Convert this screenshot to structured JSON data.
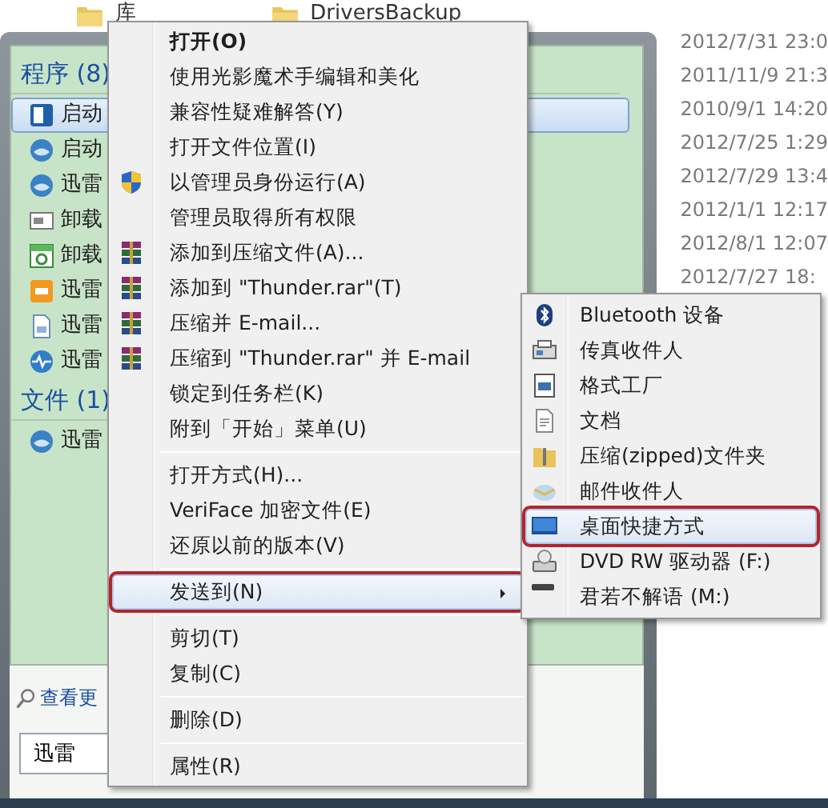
{
  "explorer": {
    "folders": [
      {
        "name": "库"
      },
      {
        "name": "DriversBackup"
      }
    ],
    "dates": [
      "2012/7/31 23:0",
      "2011/11/9 21:3",
      "2010/9/1 14:20",
      "2012/7/25 1:29",
      "2012/7/29 13:4",
      "2012/1/1 12:17",
      "2012/8/1 12:07",
      "2012/7/27 18:"
    ]
  },
  "start_menu": {
    "groups": [
      {
        "heading": "程序 (8)",
        "items": [
          {
            "label": "启动",
            "selected": true
          },
          {
            "label": "启动",
            "selected": false
          },
          {
            "label": "迅雷",
            "selected": false
          },
          {
            "label": "卸载",
            "selected": false
          },
          {
            "label": "卸载",
            "selected": false
          },
          {
            "label": "迅雷",
            "selected": false
          },
          {
            "label": "迅雷",
            "selected": false
          },
          {
            "label": "迅雷",
            "selected": false
          }
        ]
      },
      {
        "heading": "文件 (1)",
        "items": [
          {
            "label": "迅雷",
            "selected": false
          }
        ]
      }
    ],
    "see_more": "查看更",
    "search": {
      "value": "迅雷"
    }
  },
  "context_menu": {
    "items": [
      {
        "kind": "item",
        "label": "打开(O)",
        "default": true,
        "selected": false,
        "boxed": false,
        "has_submenu": false
      },
      {
        "kind": "item",
        "label": "使用光影魔术手编辑和美化",
        "default": false,
        "selected": false,
        "boxed": false,
        "has_submenu": false
      },
      {
        "kind": "item",
        "label": "兼容性疑难解答(Y)",
        "default": false,
        "selected": false,
        "boxed": false,
        "has_submenu": false
      },
      {
        "kind": "item",
        "label": "打开文件位置(I)",
        "default": false,
        "selected": false,
        "boxed": false,
        "has_submenu": false
      },
      {
        "kind": "item",
        "label": "以管理员身份运行(A)",
        "default": false,
        "selected": false,
        "boxed": false,
        "has_submenu": false
      },
      {
        "kind": "item",
        "label": "管理员取得所有权限",
        "default": false,
        "selected": false,
        "boxed": false,
        "has_submenu": false
      },
      {
        "kind": "item",
        "label": "添加到压缩文件(A)...",
        "default": false,
        "selected": false,
        "boxed": false,
        "has_submenu": false
      },
      {
        "kind": "item",
        "label": "添加到 \"Thunder.rar\"(T)",
        "default": false,
        "selected": false,
        "boxed": false,
        "has_submenu": false
      },
      {
        "kind": "item",
        "label": "压缩并 E-mail...",
        "default": false,
        "selected": false,
        "boxed": false,
        "has_submenu": false
      },
      {
        "kind": "item",
        "label": "压缩到 \"Thunder.rar\" 并 E-mail",
        "default": false,
        "selected": false,
        "boxed": false,
        "has_submenu": false
      },
      {
        "kind": "item",
        "label": "锁定到任务栏(K)",
        "default": false,
        "selected": false,
        "boxed": false,
        "has_submenu": false
      },
      {
        "kind": "item",
        "label": "附到「开始」菜单(U)",
        "default": false,
        "selected": false,
        "boxed": false,
        "has_submenu": false
      },
      {
        "kind": "separator"
      },
      {
        "kind": "item",
        "label": "打开方式(H)...",
        "default": false,
        "selected": false,
        "boxed": false,
        "has_submenu": false
      },
      {
        "kind": "item",
        "label": "VeriFace 加密文件(E)",
        "default": false,
        "selected": false,
        "boxed": false,
        "has_submenu": false
      },
      {
        "kind": "item",
        "label": "还原以前的版本(V)",
        "default": false,
        "selected": false,
        "boxed": false,
        "has_submenu": false
      },
      {
        "kind": "separator"
      },
      {
        "kind": "item",
        "label": "发送到(N)",
        "default": false,
        "selected": true,
        "boxed": true,
        "has_submenu": true
      },
      {
        "kind": "separator"
      },
      {
        "kind": "item",
        "label": "剪切(T)",
        "default": false,
        "selected": false,
        "boxed": false,
        "has_submenu": false
      },
      {
        "kind": "item",
        "label": "复制(C)",
        "default": false,
        "selected": false,
        "boxed": false,
        "has_submenu": false
      },
      {
        "kind": "separator"
      },
      {
        "kind": "item",
        "label": "删除(D)",
        "default": false,
        "selected": false,
        "boxed": false,
        "has_submenu": false
      },
      {
        "kind": "separator"
      },
      {
        "kind": "item",
        "label": "属性(R)",
        "default": false,
        "selected": false,
        "boxed": false,
        "has_submenu": false
      }
    ]
  },
  "send_to_menu": {
    "items": [
      {
        "label": "Bluetooth 设备",
        "selected": false,
        "boxed": false
      },
      {
        "label": "传真收件人",
        "selected": false,
        "boxed": false
      },
      {
        "label": "格式工厂",
        "selected": false,
        "boxed": false
      },
      {
        "label": "文档",
        "selected": false,
        "boxed": false
      },
      {
        "label": "压缩(zipped)文件夹",
        "selected": false,
        "boxed": false
      },
      {
        "label": "邮件收件人",
        "selected": false,
        "boxed": false
      },
      {
        "label": "桌面快捷方式",
        "selected": true,
        "boxed": true
      },
      {
        "label": "DVD RW 驱动器 (F:)",
        "selected": false,
        "boxed": false
      },
      {
        "label": "君若不解语 (M:)",
        "selected": false,
        "boxed": false
      }
    ]
  }
}
